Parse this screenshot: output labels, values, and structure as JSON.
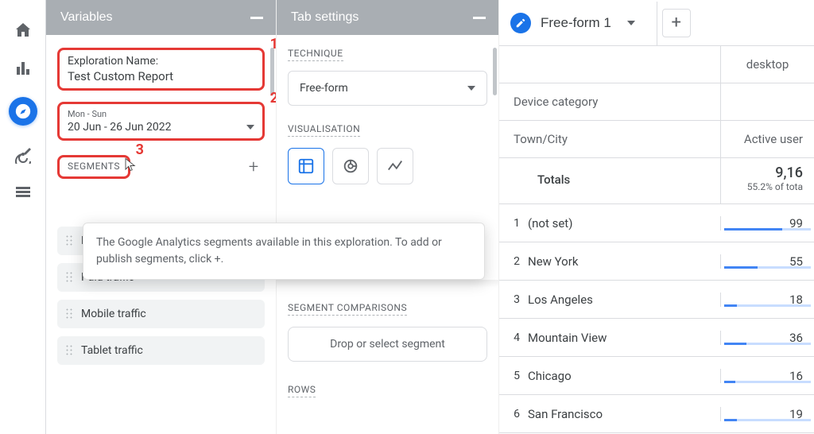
{
  "variables": {
    "title": "Variables",
    "exploration_label": "Exploration Name:",
    "exploration_name": "Test Custom Report",
    "date_preset": "Mon - Sun",
    "date_range": "20 Jun - 26 Jun 2022",
    "segments_label": "SEGMENTS",
    "segments_tooltip": "The Google Analytics segments available in this exploration. To add or publish segments, click  +.",
    "annotations": {
      "one": "1",
      "two": "2",
      "three": "3"
    },
    "segment_chips": {
      "direct": "Direct traffic",
      "paid": "Paid traffic",
      "mobile": "Mobile traffic",
      "tablet": "Tablet traffic"
    }
  },
  "tabsettings": {
    "title": "Tab settings",
    "technique_label": "TECHNIQUE",
    "technique_value": "Free-form",
    "visualisation_label": "VISUALISATION",
    "segment_comparisons_label": "SEGMENT COMPARISONS",
    "segment_dropzone": "Drop or select segment",
    "rows_label": "ROWS"
  },
  "report": {
    "tab_name": "Free-form 1",
    "desktop_label": "desktop",
    "device_category_label": "Device category",
    "town_city_label": "Town/City",
    "metric_header": "Active user",
    "totals_label": "Totals",
    "totals_value": "9,16",
    "totals_sub": "55.2% of tota",
    "rows": [
      {
        "idx": "1",
        "city": "(not set)",
        "val": "99",
        "bar_pct": 62
      },
      {
        "idx": "2",
        "city": "New York",
        "val": "55",
        "bar_pct": 36
      },
      {
        "idx": "3",
        "city": "Los Angeles",
        "val": "18",
        "bar_pct": 14
      },
      {
        "idx": "4",
        "city": "Mountain View",
        "val": "36",
        "bar_pct": 24
      },
      {
        "idx": "5",
        "city": "Chicago",
        "val": "16",
        "bar_pct": 12
      },
      {
        "idx": "6",
        "city": "San Francisco",
        "val": "19",
        "bar_pct": 14
      }
    ]
  }
}
